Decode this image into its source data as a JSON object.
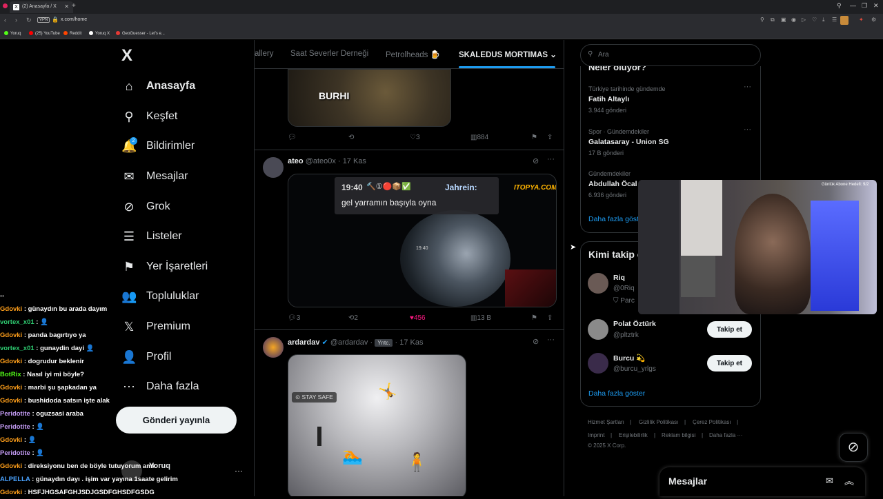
{
  "browser": {
    "tab_title": "(2) Anasayfa / X",
    "tab_favicon": "x-logo",
    "url": "x.com/home",
    "vpn_label": "VPN",
    "bookmarks": [
      {
        "label": "Yoruq",
        "color": "#53fc18"
      },
      {
        "label": "(25) YouTube",
        "color": "#ff0000"
      },
      {
        "label": "Reddit",
        "color": "#ff4500"
      },
      {
        "label": "Yoruq X",
        "color": "#ffffff"
      },
      {
        "label": "GeoGuesser - Let's e...",
        "color": "#e53935"
      }
    ]
  },
  "sidebar": {
    "logo": "X",
    "notification_count": "2",
    "items": [
      {
        "label": "Anasayfa",
        "icon": "home-icon",
        "glyph": "⌂"
      },
      {
        "label": "Keşfet",
        "icon": "search-icon",
        "glyph": "⚲"
      },
      {
        "label": "Bildirimler",
        "icon": "bell-icon",
        "glyph": "🔔"
      },
      {
        "label": "Mesajlar",
        "icon": "mail-icon",
        "glyph": "✉"
      },
      {
        "label": "Grok",
        "icon": "grok-icon",
        "glyph": "⊘"
      },
      {
        "label": "Listeler",
        "icon": "list-icon",
        "glyph": "☰"
      },
      {
        "label": "Yer İşaretleri",
        "icon": "bookmark-icon",
        "glyph": "⚑"
      },
      {
        "label": "Topluluklar",
        "icon": "people-icon",
        "glyph": "👥"
      },
      {
        "label": "Premium",
        "icon": "x-icon",
        "glyph": "𝕏"
      },
      {
        "label": "Profil",
        "icon": "person-icon",
        "glyph": "👤"
      },
      {
        "label": "Daha fazla",
        "icon": "more-circle-icon",
        "glyph": "⋯"
      }
    ],
    "post_button": "Gönderi yayınla",
    "account_name": "Yoruq"
  },
  "chat": [
    {
      "user": "--",
      "color": "#ffffff",
      "msg": ""
    },
    {
      "user": "Gdovki",
      "color": "#ff9f1a",
      "msg": "günaydın bu arada dayım"
    },
    {
      "user": "vortex_x01",
      "color": "#2ecc71",
      "msg": "👤"
    },
    {
      "user": "Gdovki",
      "color": "#ff9f1a",
      "msg": "panda bagırtıyo ya"
    },
    {
      "user": "vortex_x01",
      "color": "#2ecc71",
      "msg": "gunaydin dayi 👤"
    },
    {
      "user": "Gdovki",
      "color": "#ff9f1a",
      "msg": "dogrudur beklenir"
    },
    {
      "user": "BotRix",
      "color": "#53fc18",
      "msg": "Nasıl iyi mi böyle?"
    },
    {
      "user": "Gdovki",
      "color": "#ff9f1a",
      "msg": "marbi şu şapkadan ya"
    },
    {
      "user": "Gdovki",
      "color": "#ff9f1a",
      "msg": "bushidoda satsın işte alak"
    },
    {
      "user": "Peridotite",
      "color": "#c39bf4",
      "msg": "oguzsasi araba"
    },
    {
      "user": "Peridotite",
      "color": "#c39bf4",
      "msg": "👤"
    },
    {
      "user": "Gdovki",
      "color": "#ff9f1a",
      "msg": "👤"
    },
    {
      "user": "Peridotite",
      "color": "#c39bf4",
      "msg": "👤"
    },
    {
      "user": "Gdovki",
      "color": "#ff9f1a",
      "msg": "direksiyonu ben de böyle tutuyorum amk"
    },
    {
      "user": "ALPELLA",
      "color": "#4aa3ff",
      "msg": "günaydın dayı . işim var yayına 1saate gelirim"
    },
    {
      "user": "Gdovki",
      "color": "#ff9f1a",
      "msg": "HSFJHGSAFGHJSDJGSDFGHSDFGSDG"
    }
  ],
  "center": {
    "lists": [
      "allery",
      "Saat Severler Derneği",
      "Petrolheads 🍺",
      "SKALEDUS MORTIMAS"
    ],
    "tweet1": {
      "meme_text": "BURHI",
      "replies": "",
      "reposts": "",
      "likes": "3",
      "views": "884"
    },
    "tweet2": {
      "name": "ateo",
      "handle": "@ateo0x",
      "time": "17 Kas",
      "chat_time": "19:40",
      "chat_user": "Jahrein:",
      "chat_msg": "gel yarramın başıyla oyna",
      "watermark": "ITOPYA.COM",
      "replies": "3",
      "reposts": "2",
      "likes": "456",
      "views": "13 B"
    },
    "tweet3": {
      "name": "ardardav",
      "handle": "@ardardav",
      "tag": "Yntc.",
      "time": "17 Kas",
      "media_label": "STAY SAFE"
    }
  },
  "right": {
    "search_placeholder": "Ara",
    "trends_heading": "Neler oluyor?",
    "trends": [
      {
        "meta": "Türkiye tarihinde gündemde",
        "title": "Fatih Altaylı",
        "count": "3.944 gönderi"
      },
      {
        "meta": "Spor · Gündemdekiler",
        "title": "Galatasaray - Union SG",
        "count": "17 B gönderi"
      },
      {
        "meta": "Gündemdekiler",
        "title": "Abdullah Öcal",
        "count": "6.936 gönderi"
      }
    ],
    "trends_more": "Daha fazla göster",
    "follow_heading": "Kimi takip et",
    "follow": [
      {
        "name": "Riq",
        "handle": "@0Riq",
        "extra": "Parc",
        "button": ""
      },
      {
        "name": "Polat Öztürk",
        "handle": "@pltztrk",
        "extra": "",
        "button": "Takip et"
      },
      {
        "name": "Burcu 💫",
        "handle": "@burcu_yrlgs",
        "extra": "",
        "button": "Takip et"
      }
    ],
    "follow_more": "Daha fazla göster",
    "footer": [
      "Hizmet Şartları",
      "Gizlilik Politikası",
      "Çerez Politikası",
      "Imprint",
      "Erişilebilirlik",
      "Reklam bilgisi",
      "Daha fazla ···",
      "© 2025 X Corp."
    ],
    "webcam_label": "Günlük Abone Hedefi: 9/2",
    "messages_drawer": "Mesajlar"
  },
  "colors": {
    "accent": "#1d9bf0",
    "like": "#f91880",
    "border": "#2f3336",
    "muted": "#71767b"
  }
}
